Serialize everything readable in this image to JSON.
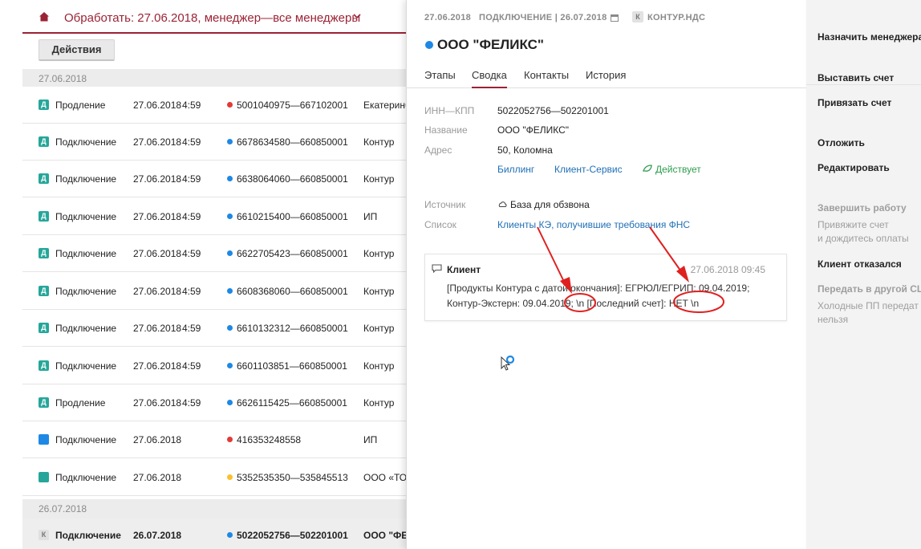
{
  "list": {
    "header_title": "Обработать: 27.06.2018, менеджер—все менеджеры",
    "actions_label": "Действия",
    "groups": [
      {
        "label": "27.06.2018"
      },
      {
        "label": "26.07.2018"
      }
    ],
    "rows": [
      {
        "icon": "Д",
        "icon_color": "#26a69a",
        "type": "Продление",
        "date": "27.06.2018",
        "time": "4:59",
        "status_color": "#e53935",
        "inn": "5001040975—667102001",
        "org": "Екатеринб"
      },
      {
        "icon": "Д",
        "icon_color": "#26a69a",
        "type": "Подключение",
        "date": "27.06.2018",
        "time": "4:59",
        "status_color": "#1e88e5",
        "inn": "6678634580—660850001",
        "org": "Контур"
      },
      {
        "icon": "Д",
        "icon_color": "#26a69a",
        "type": "Подключение",
        "date": "27.06.2018",
        "time": "4:59",
        "status_color": "#1e88e5",
        "inn": "6638064060—660850001",
        "org": "Контур"
      },
      {
        "icon": "Д",
        "icon_color": "#26a69a",
        "type": "Подключение",
        "date": "27.06.2018",
        "time": "4:59",
        "status_color": "#1e88e5",
        "inn": "6610215400—660850001",
        "org": "ИП"
      },
      {
        "icon": "Д",
        "icon_color": "#26a69a",
        "type": "Подключение",
        "date": "27.06.2018",
        "time": "4:59",
        "status_color": "#1e88e5",
        "inn": "6622705423—660850001",
        "org": "Контур"
      },
      {
        "icon": "Д",
        "icon_color": "#26a69a",
        "type": "Подключение",
        "date": "27.06.2018",
        "time": "4:59",
        "status_color": "#1e88e5",
        "inn": "6608368060—660850001",
        "org": "Контур"
      },
      {
        "icon": "Д",
        "icon_color": "#26a69a",
        "type": "Подключение",
        "date": "27.06.2018",
        "time": "4:59",
        "status_color": "#1e88e5",
        "inn": "6610132312—660850001",
        "org": "Контур"
      },
      {
        "icon": "Д",
        "icon_color": "#26a69a",
        "type": "Подключение",
        "date": "27.06.2018",
        "time": "4:59",
        "status_color": "#1e88e5",
        "inn": "6601103851—660850001",
        "org": "Контур"
      },
      {
        "icon": "Д",
        "icon_color": "#26a69a",
        "type": "Продление",
        "date": "27.06.2018",
        "time": "4:59",
        "status_color": "#1e88e5",
        "inn": "6626115425—660850001",
        "org": "Контур"
      },
      {
        "icon": "",
        "icon_color": "#1e88e5",
        "type": "Подключение",
        "date": "27.06.2018",
        "time": "",
        "status_color": "#e53935",
        "inn": "416353248558",
        "org": "ИП"
      },
      {
        "icon": "",
        "icon_color": "#26a69a",
        "type": "Подключение",
        "date": "27.06.2018",
        "time": "",
        "status_color": "#fbc02d",
        "inn": "5352535350—535845513",
        "org": "ООО «ТОР"
      },
      {
        "icon": "К",
        "icon_color": "#e0e0e0",
        "type": "Подключение",
        "date": "26.07.2018",
        "time": "",
        "status_color": "#1e88e5",
        "inn": "5022052756—502201001",
        "org": "ООО \"ФЕ"
      }
    ]
  },
  "card": {
    "meta_date": "27.06.2018",
    "meta_stage": "ПОДКЛЮЧЕНИЕ | 26.07.2018",
    "meta_badge": "К",
    "meta_product": "КОНТУР.НДС",
    "title": "ООО \"ФЕЛИКС\"",
    "status_color": "#1e88e5",
    "tabs": [
      {
        "label": "Этапы"
      },
      {
        "label": "Сводка"
      },
      {
        "label": "Контакты"
      },
      {
        "label": "История"
      }
    ],
    "inn_label": "ИНН—КПП",
    "inn_value": "5022052756—502201001",
    "name_label": "Название",
    "name_value": "ООО \"ФЕЛИКС\"",
    "address_label": "Адрес",
    "address_value": "50, Коломна",
    "links": {
      "billing": "Биллинг",
      "client_service": "Клиент-Сервис",
      "active": "Действует"
    },
    "source_label": "Источник",
    "source_value": "База для обзвона",
    "list_label": "Список",
    "list_value": "Клиенты КЭ, получившие требования ФНС",
    "comment": {
      "author": "Клиент",
      "date": "27.06.2018 09:45",
      "line1": "[Продукты Контура с датой окончания]: ЕГРЮЛ/ЕГРИП: 09.04.2019;",
      "line2": "Контур-Экстерн: 09.04.2019; \\n [Последний счет]: НЕТ \\n"
    }
  },
  "menu": {
    "assign_manager": "Назначить менеджера",
    "invoice": "Выставить счет",
    "bind_invoice": "Привязать счет",
    "postpone": "Отложить",
    "edit": "Редактировать",
    "finish_work": "Завершить работу",
    "finish_hint1": "Привяжите счет",
    "finish_hint2": "и дождитесь оплаты",
    "client_refused": "Клиент отказался",
    "transfer": "Передать в другой CL",
    "transfer_hint1": "Холодные ПП передат",
    "transfer_hint2": "нельзя"
  },
  "colors": {
    "brand": "#9b2335",
    "link": "#1f6fb5",
    "annotation": "#e02020"
  }
}
